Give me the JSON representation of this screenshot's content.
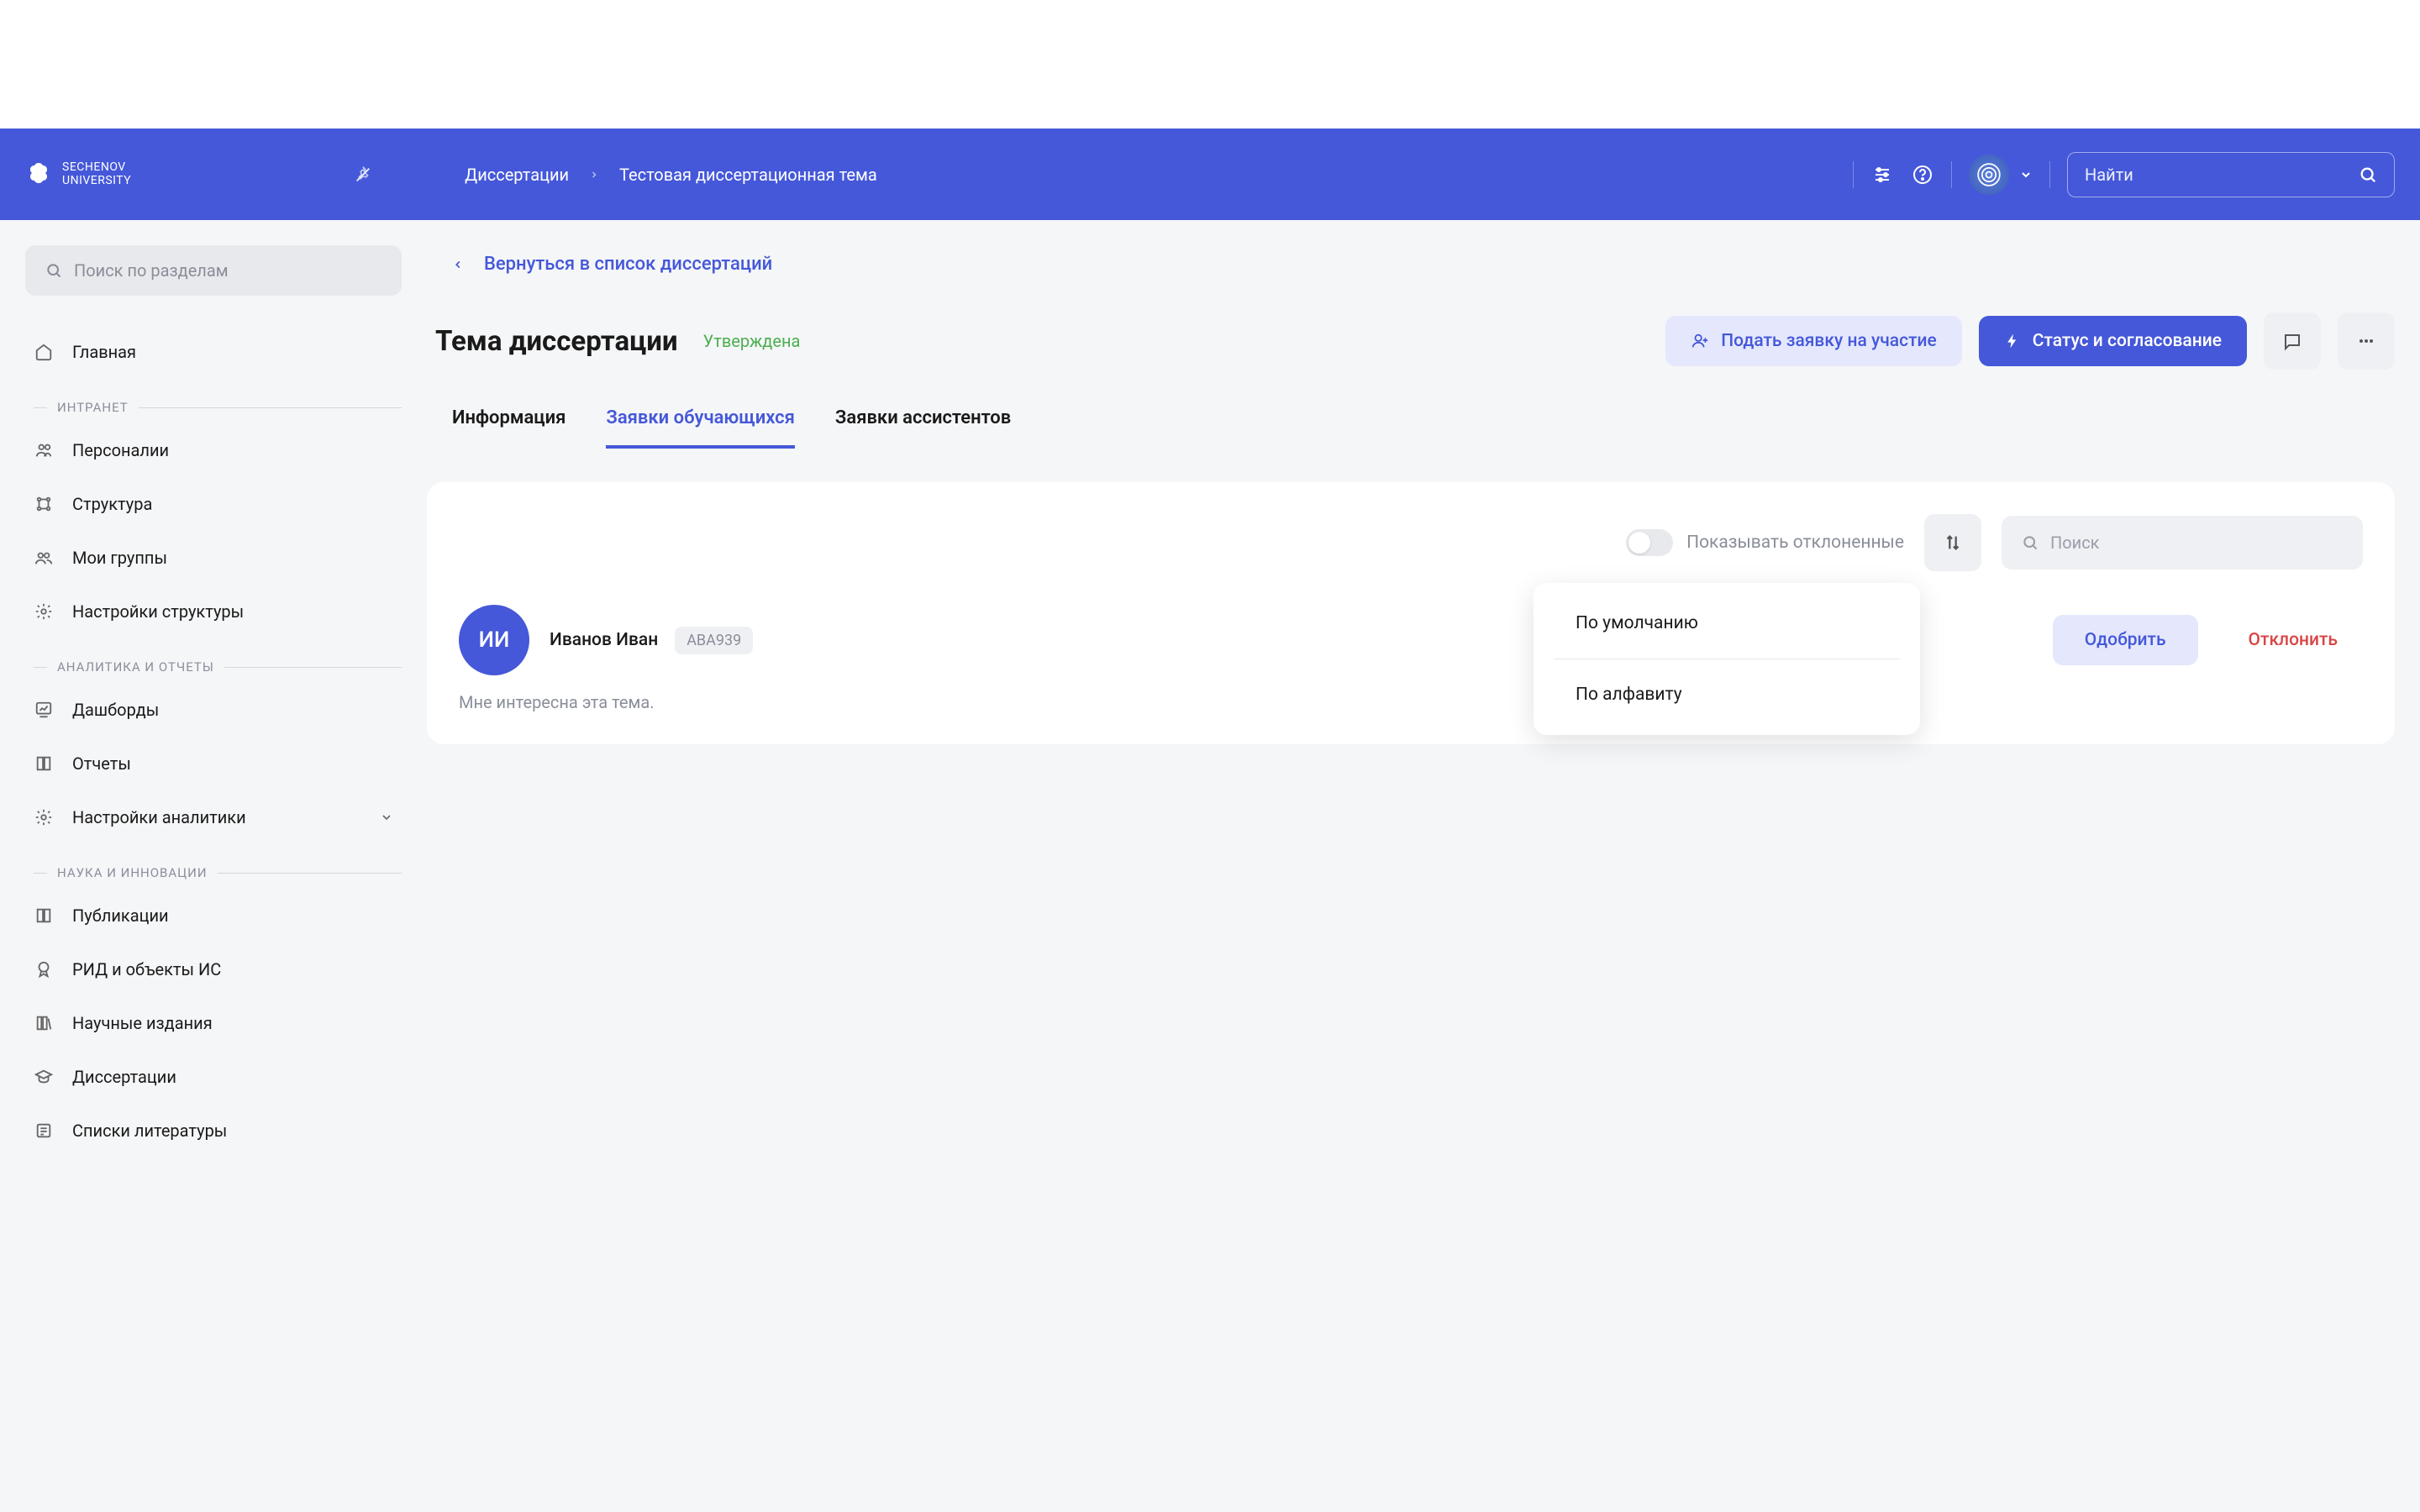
{
  "logo": {
    "line1": "SECHENOV",
    "line2": "UNIVERSITY"
  },
  "breadcrumb": {
    "parent": "Диссертации",
    "current": "Тестовая диссертационная тема"
  },
  "headerSearch": {
    "placeholder": "Найти"
  },
  "sidebar": {
    "searchPlaceholder": "Поиск по разделам",
    "home": "Главная",
    "sections": {
      "intranet": {
        "title": "ИНТРАНЕТ",
        "items": [
          "Персоналии",
          "Структура",
          "Мои группы",
          "Настройки структуры"
        ]
      },
      "analytics": {
        "title": "АНАЛИТИКА И ОТЧЕТЫ",
        "items": [
          "Дашборды",
          "Отчеты",
          "Настройки аналитики"
        ]
      },
      "science": {
        "title": "НАУКА И ИННОВАЦИИ",
        "items": [
          "Публикации",
          "РИД и объекты ИС",
          "Научные издания",
          "Диссертации",
          "Списки литературы"
        ]
      }
    }
  },
  "backLink": "Вернуться в список диссертаций",
  "page": {
    "title": "Тема диссертации",
    "status": "Утверждена"
  },
  "actions": {
    "apply": "Подать заявку на участие",
    "status": "Статус и согласование"
  },
  "tabs": {
    "info": "Информация",
    "students": "Заявки обучающихся",
    "assistants": "Заявки ассистентов"
  },
  "toolbar": {
    "toggleLabel": "Показывать отклоненные",
    "searchPlaceholder": "Поиск"
  },
  "dropdown": {
    "default": "По умолчанию",
    "alphabet": "По алфавиту"
  },
  "applicant": {
    "initials": "ИИ",
    "name": "Иванов Иван",
    "code": "АВА939",
    "approve": "Одобрить",
    "reject": "Отклонить",
    "note": "Мне интересна эта тема."
  }
}
